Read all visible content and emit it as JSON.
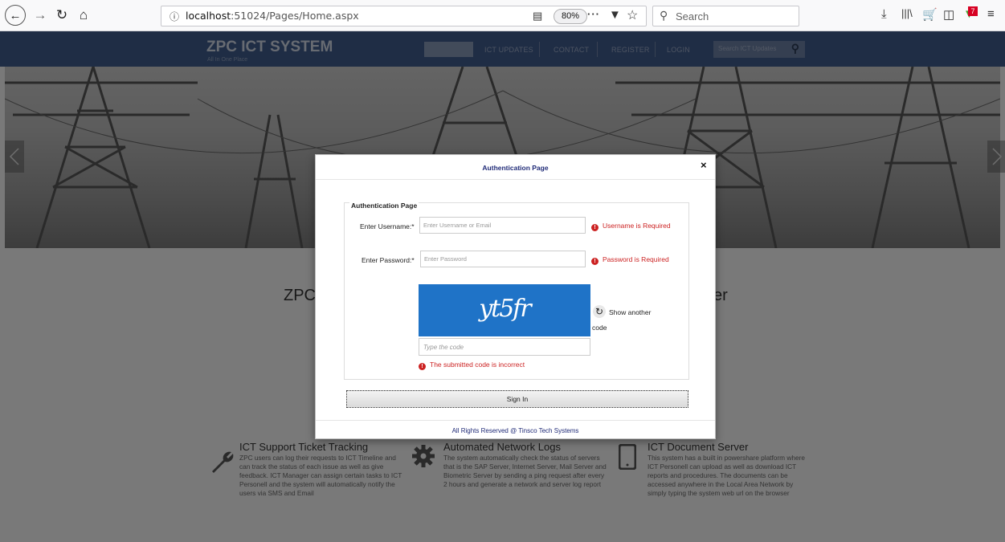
{
  "browser": {
    "url_host": "localhost",
    "url_rest": ":51024/Pages/Home.aspx",
    "zoom": "80%",
    "search_placeholder": "Search",
    "addon_badge": "7",
    "icons": [
      "back-icon",
      "forward-icon",
      "reload-icon",
      "home-icon",
      "info-icon",
      "reader-icon",
      "more-icon",
      "pocket-icon",
      "bookmark-star-icon",
      "search-icon",
      "download-icon",
      "library-icon",
      "cart-icon",
      "sidebar-icon",
      "addon-icon",
      "menu-icon"
    ]
  },
  "site": {
    "brand": "ZPC ICT SYSTEM",
    "tagline": "All In One Place",
    "nav": [
      "ICT UPDATES",
      "CONTACT",
      "REGISTER",
      "LOGIN"
    ],
    "search_placeholder": "Search ICT Updates",
    "headline_left": "ZPC",
    "headline_right": "er",
    "features": [
      {
        "title": "ICT Support Ticket Tracking",
        "text": "ZPC users can log their requests to ICT Timeline and can track the status of each issue as well as give feedback. ICT Manager can assign certain tasks to ICT Personell and the system will automatically notify the users via SMS and Email",
        "icon": "wrench-icon"
      },
      {
        "title": "Automated Network Logs",
        "text": "The system automatically check the status of servers that is the SAP Server, Internet Server, Mail Server and Biometric Server by sending a ping request after every 2 hours and generate a network and server log report",
        "icon": "gear-icon"
      },
      {
        "title": "ICT Document Server",
        "text": "This system has a built in powershare platform where ICT Personell can upload as well as download ICT reports and procedures. The documents can be accessed anywhere in the Local Area Network by simply typing the system web url on the browser",
        "icon": "mobile-icon"
      }
    ]
  },
  "modal": {
    "title": "Authentication Page",
    "close": "×",
    "legend": "Authentication Page",
    "username_label": "Enter Username:*",
    "username_placeholder": "Enter Username or Email",
    "username_error": "Username is Required",
    "password_label": "Enter Password:*",
    "password_placeholder": "Enter Password",
    "password_error": "Password is Required",
    "captcha_text": "yt5fr",
    "show_another": "Show another",
    "show_another_2": "code",
    "code_placeholder": "Type the code",
    "code_error": "The submitted code is incorrect",
    "signin": "Sign In",
    "footer": "All Rights Reserved @ Tinsco Tech Systems"
  }
}
